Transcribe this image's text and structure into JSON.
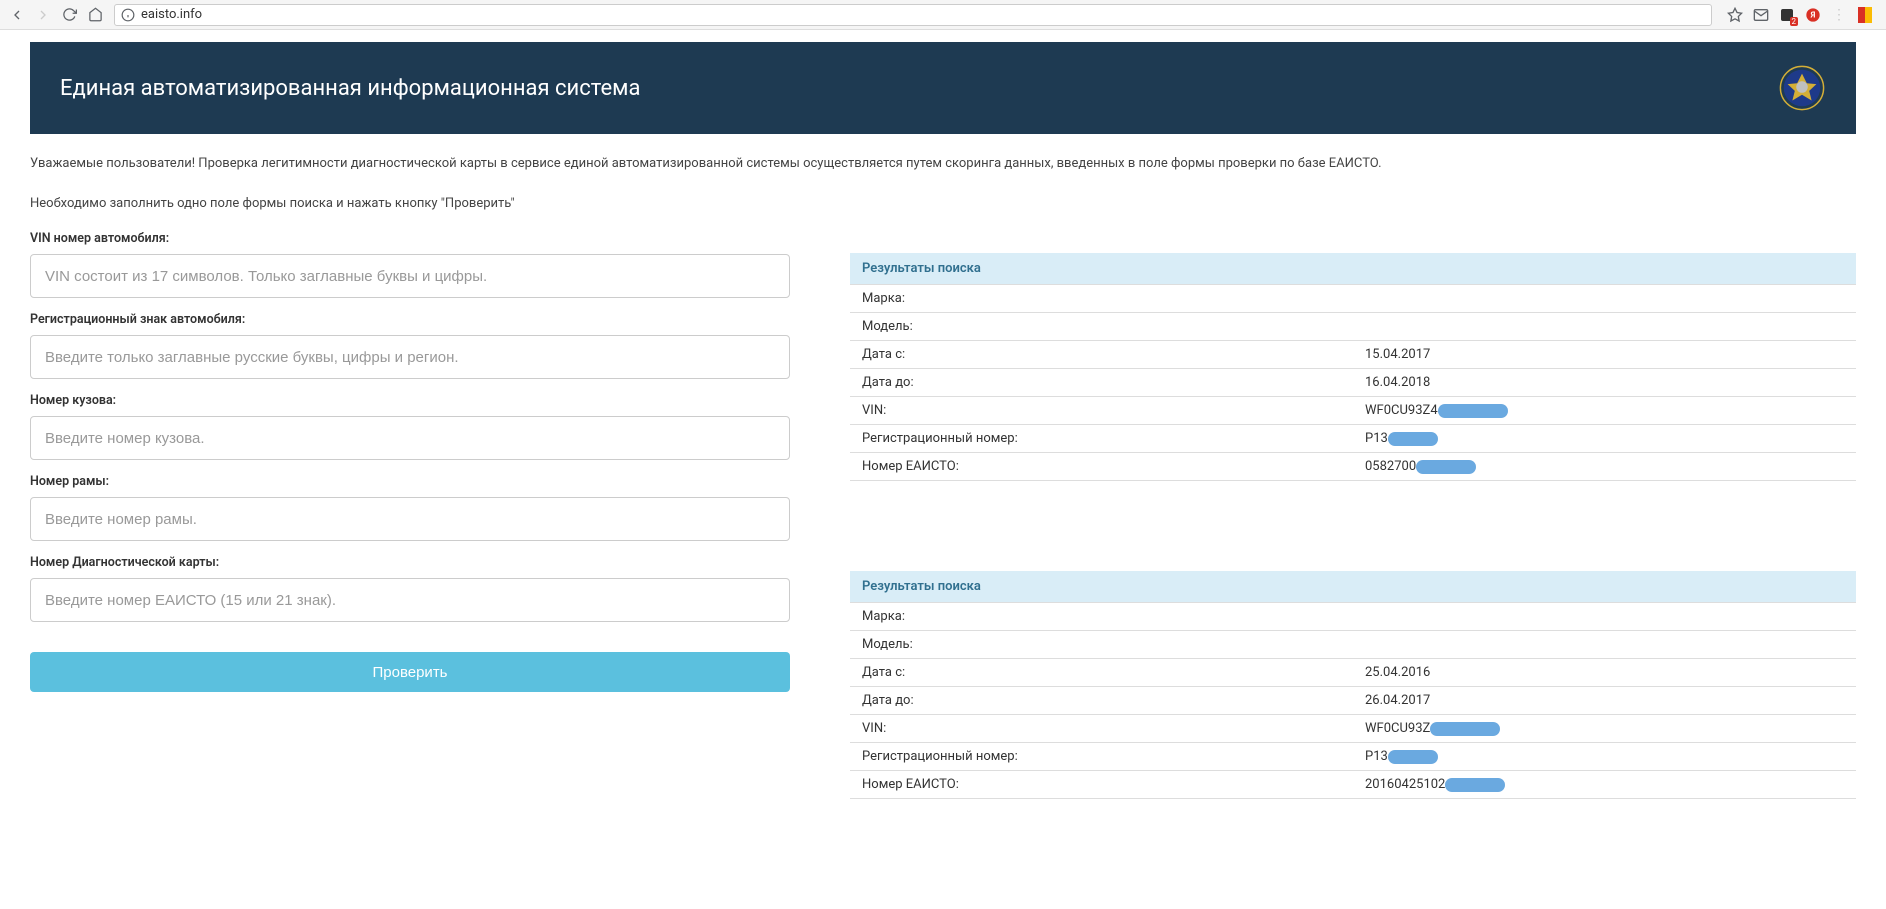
{
  "browser": {
    "url": "eaisto.info"
  },
  "header": {
    "title": "Единая автоматизированная информационная система"
  },
  "intro": {
    "line1": "Уважаемые пользователи! Проверка легитимности диагностической карты в сервисе единой автоматизированной системы осуществляется путем скоринга данных, введенных в поле формы проверки по базе ЕАИСТО.",
    "line2": "Необходимо заполнить одно поле формы поиска и нажать кнопку \"Проверить\""
  },
  "form": {
    "vin_label": "VIN номер автомобиля:",
    "vin_placeholder": "VIN состоит из 17 символов. Только заглавные буквы и цифры.",
    "reg_label": "Регистрационный знак автомобиля:",
    "reg_placeholder": "Введите только заглавные русские буквы, цифры и регион.",
    "body_label": "Номер кузова:",
    "body_placeholder": "Введите номер кузова.",
    "frame_label": "Номер рамы:",
    "frame_placeholder": "Введите номер рамы.",
    "diag_label": "Номер Диагностической карты:",
    "diag_placeholder": "Введите номер ЕАИСТО (15 или 21 знак).",
    "submit": "Проверить"
  },
  "results": {
    "header": "Результаты поиска",
    "labels": {
      "brand": "Марка:",
      "model": "Модель:",
      "date_from": "Дата с:",
      "date_to": "Дата до:",
      "vin": "VIN:",
      "reg_num": "Регистрационный номер:",
      "eaisto_num": "Номер ЕАИСТО:"
    },
    "block1": {
      "brand": "",
      "model": "",
      "date_from": "15.04.2017",
      "date_to": "16.04.2018",
      "vin": "WF0CU93Z4",
      "reg_num": "Р13",
      "eaisto_num": "0582700"
    },
    "block2": {
      "brand": "",
      "model": "",
      "date_from": "25.04.2016",
      "date_to": "26.04.2017",
      "vin": "WF0CU93Z",
      "reg_num": "Р13",
      "eaisto_num": "20160425102"
    }
  }
}
